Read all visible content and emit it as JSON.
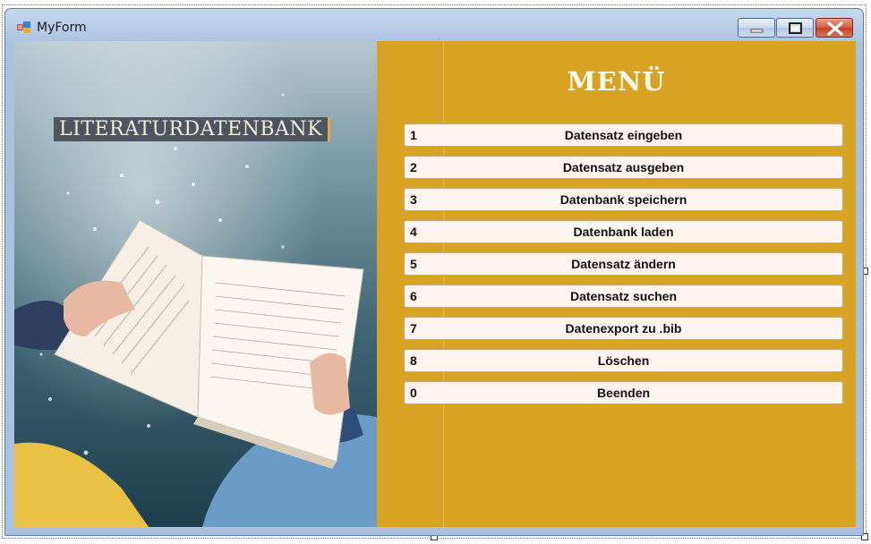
{
  "window": {
    "title": "MyForm"
  },
  "photo": {
    "label": "LITERATURDATENBANK"
  },
  "menu": {
    "title": "MENÜ",
    "items": [
      {
        "num": "1",
        "label": "Datensatz eingeben"
      },
      {
        "num": "2",
        "label": "Datensatz ausgeben"
      },
      {
        "num": "3",
        "label": "Datenbank speichern"
      },
      {
        "num": "4",
        "label": "Datenbank laden"
      },
      {
        "num": "5",
        "label": "Datensatz ändern"
      },
      {
        "num": "6",
        "label": "Datensatz suchen"
      },
      {
        "num": "7",
        "label": "Datenexport zu .bib"
      },
      {
        "num": "8",
        "label": "Löschen"
      },
      {
        "num": "0",
        "label": "Beenden"
      }
    ]
  },
  "colors": {
    "menu_background": "#d8a323",
    "button_background": "#fdf3ef",
    "title_bar": "#aac2e2"
  }
}
